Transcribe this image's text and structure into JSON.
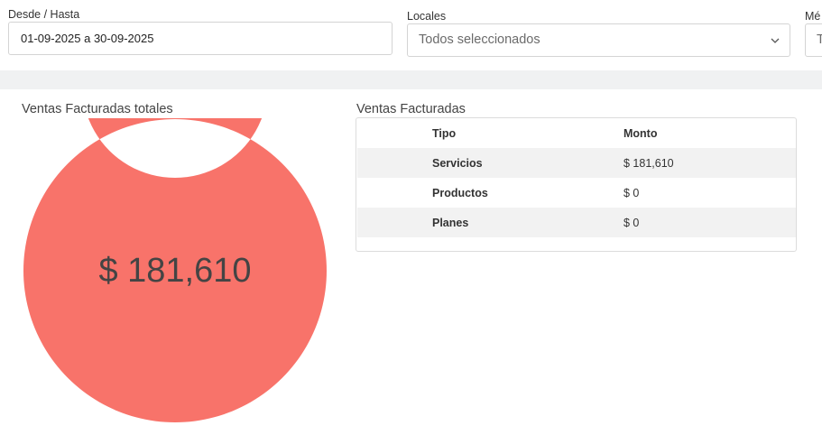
{
  "filters": {
    "date": {
      "label": "Desde / Hasta",
      "value": "01-09-2025 a 30-09-2025"
    },
    "locales": {
      "label": "Locales",
      "value": "Todos seleccionados",
      "icon": "chevron-down-icon"
    },
    "third": {
      "label": "Mé",
      "value": "T"
    }
  },
  "summary": {
    "title": "Ventas Facturadas totales",
    "total_label": "$ 181,610",
    "donut_color": "#f8736a",
    "segments": [
      {
        "name": "Servicios",
        "value": 181610
      },
      {
        "name": "Productos",
        "value": 0
      },
      {
        "name": "Planes",
        "value": 0
      }
    ]
  },
  "table": {
    "title": "Ventas Facturadas",
    "headers": [
      "Tipo",
      "Monto"
    ],
    "rows": [
      [
        "Servicios",
        "$ 181,610"
      ],
      [
        "Productos",
        "$ 0"
      ],
      [
        "Planes",
        "$ 0"
      ]
    ]
  }
}
